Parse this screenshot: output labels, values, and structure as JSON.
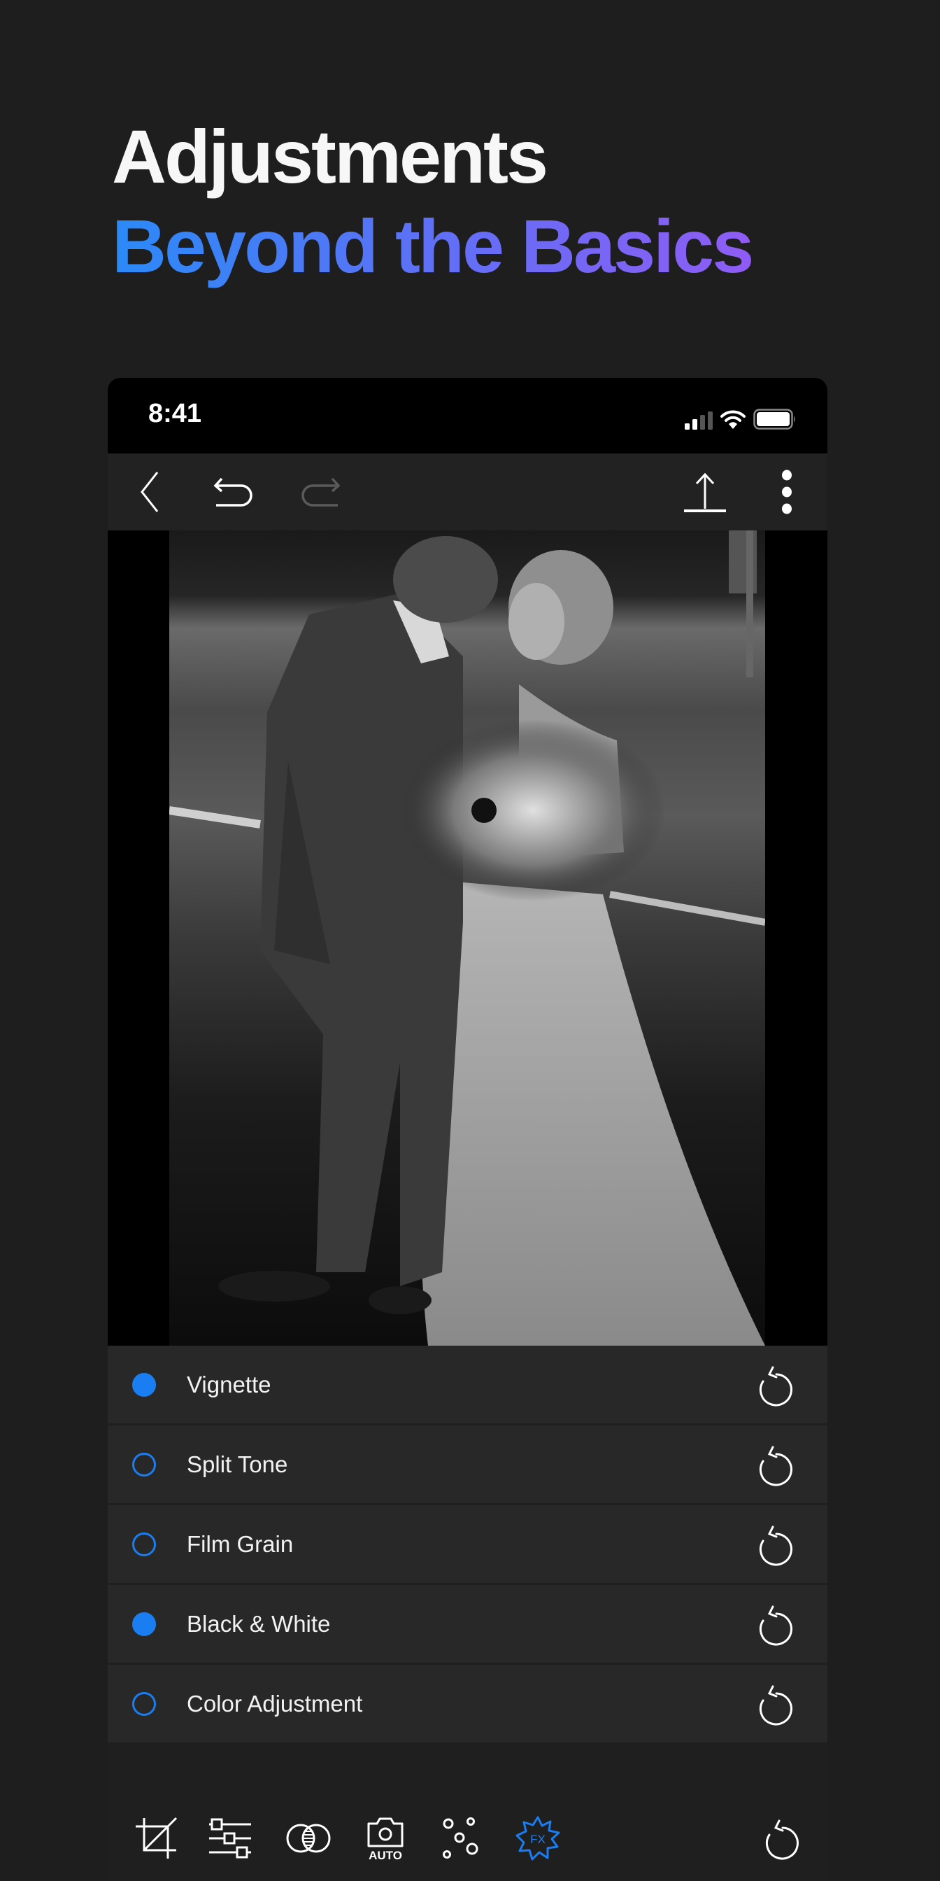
{
  "headline": {
    "line1": "Adjustments",
    "line2": "Beyond the Basics",
    "gradient_colors": [
      "#2b8af7",
      "#8f5cf5"
    ]
  },
  "status_bar": {
    "time": "8:41",
    "signal_bars_active": 2,
    "signal_bars_total": 4,
    "wifi": "wifi-icon",
    "battery": "battery-full-icon"
  },
  "toolbar": {
    "back": "chevron-left-icon",
    "undo": "undo-icon",
    "redo": "redo-icon",
    "redo_enabled": false,
    "share": "share-upload-icon",
    "more": "more-vertical-icon"
  },
  "photo": {
    "description": "Black and white wedding photo of a groom kissing a bride holding a bouquet",
    "filter": "black-and-white"
  },
  "adjustments": [
    {
      "label": "Vignette",
      "enabled": true
    },
    {
      "label": "Split Tone",
      "enabled": false
    },
    {
      "label": "Film Grain",
      "enabled": false
    },
    {
      "label": "Black & White",
      "enabled": true
    },
    {
      "label": "Color Adjustment",
      "enabled": false
    }
  ],
  "bottom_tools": [
    {
      "name": "crop-icon",
      "active": false
    },
    {
      "name": "sliders-icon",
      "active": false
    },
    {
      "name": "blend-icon",
      "active": false
    },
    {
      "name": "auto-camera-icon",
      "label": "AUTO",
      "active": false
    },
    {
      "name": "dots-icon",
      "active": false
    },
    {
      "name": "fx-icon",
      "label": "FX",
      "active": true
    },
    {
      "name": "reset-icon",
      "active": false
    }
  ],
  "colors": {
    "accent": "#1a7ef2",
    "background": "#1e1e1e",
    "row": "#282828"
  }
}
